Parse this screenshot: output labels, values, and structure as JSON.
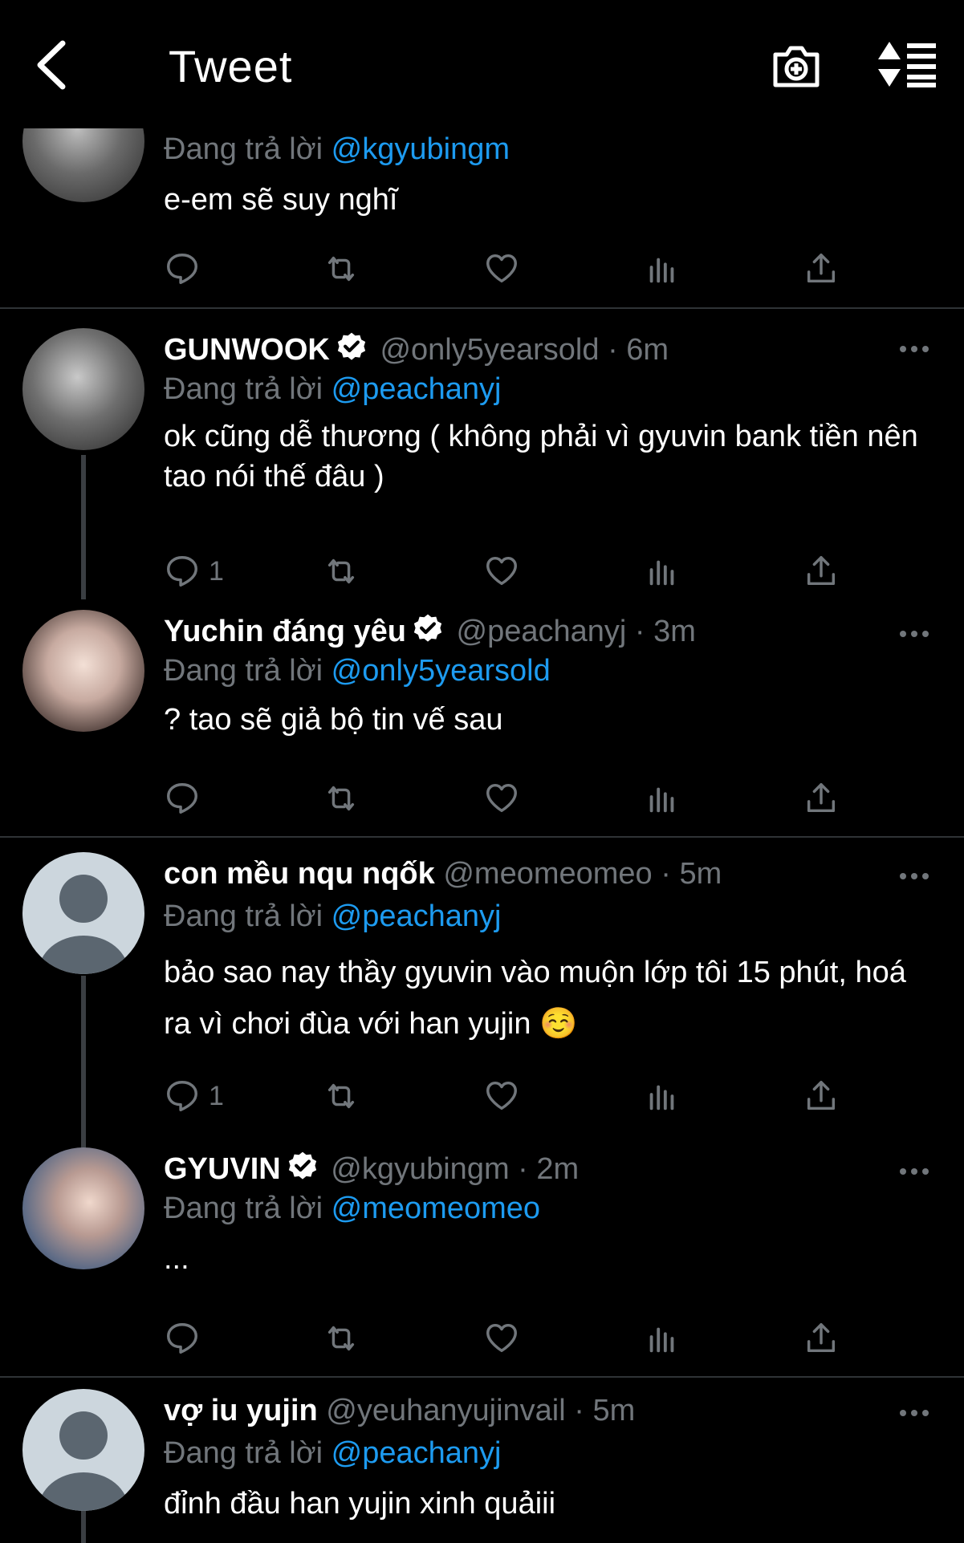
{
  "header": {
    "title": "Tweet"
  },
  "reply_prefix": "Đang trả lời",
  "tweets": [
    {
      "display_name": "",
      "handle": "",
      "time": "",
      "reply_to": "@kgyubingm",
      "text": "e-em sẽ suy nghĩ",
      "reply_count": ""
    },
    {
      "display_name": "GUNWOOK",
      "handle": "@only5yearsold",
      "separator": "·",
      "time": "6m",
      "reply_to": "@peachanyj",
      "text": "ok cũng dễ thương ( không phải vì gyuvin bank tiền nên tao nói thế đâu )",
      "reply_count": "1"
    },
    {
      "display_name": "Yuchin đáng yêu",
      "handle": "@peachanyj",
      "separator": "·",
      "time": "3m",
      "reply_to": "@only5yearsold",
      "text": "? tao sẽ giả bộ tin vế sau",
      "reply_count": ""
    },
    {
      "display_name": "con mều nqu nqốk",
      "handle": "@meomeomeo",
      "separator": "·",
      "time": "5m",
      "reply_to": "@peachanyj",
      "text": "bảo sao nay thầy gyuvin vào muộn lớp tôi 15 phút, hoá ra vì chơi đùa với han yujin ☺️",
      "reply_count": "1"
    },
    {
      "display_name": "GYUVIN",
      "handle": "@kgyubingm",
      "separator": "·",
      "time": "2m",
      "reply_to": "@meomeomeo",
      "text": "...",
      "reply_count": ""
    },
    {
      "display_name": "vợ iu yujin",
      "handle": "@yeuhanyujinvail",
      "separator": "·",
      "time": "5m",
      "reply_to": "@peachanyj",
      "text": "đỉnh đầu han yujin xinh quảiii",
      "reply_count": ""
    }
  ],
  "colors": {
    "link": "#1d9bf0",
    "muted": "#71767b",
    "verified": "#ffffff",
    "background": "#000000"
  },
  "icons": [
    "back-icon",
    "camera-plus-icon",
    "sort-icon",
    "reply-icon",
    "retweet-icon",
    "like-icon",
    "views-icon",
    "share-icon",
    "more-icon",
    "verified-icon"
  ]
}
